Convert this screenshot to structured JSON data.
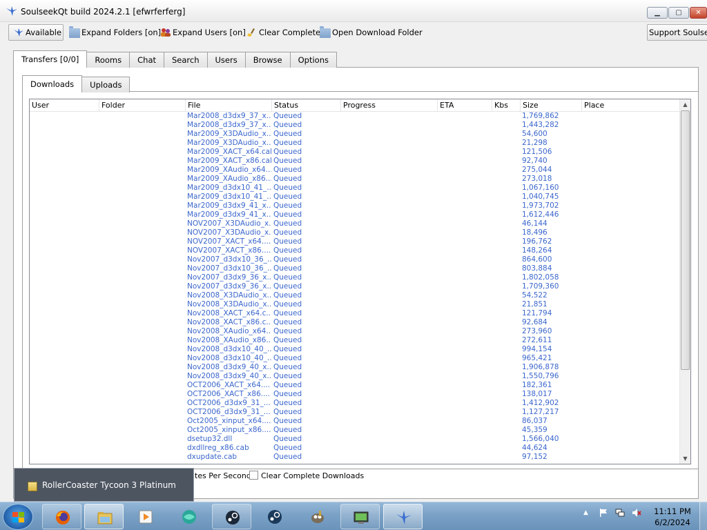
{
  "window": {
    "title": "SoulseekQt build 2024.2.1 [efwrferferg]"
  },
  "toolbar": {
    "available": "Available",
    "expand_folders": "Expand Folders [on]",
    "expand_users": "Expand Users [on]",
    "clear_complete": "Clear Complete",
    "open_download_folder": "Open Download Folder",
    "support": "Support Soulseek"
  },
  "main_tabs": [
    "Transfers [0/0]",
    "Rooms",
    "Chat",
    "Search",
    "Users",
    "Browse",
    "Options"
  ],
  "sub_tabs": [
    "Downloads",
    "Uploads"
  ],
  "columns": [
    "User",
    "Folder",
    "File",
    "Status",
    "Progress",
    "ETA",
    "Kbs",
    "Size",
    "Place"
  ],
  "rows": [
    {
      "file": "Mar2008_d3dx9_37_x...",
      "status": "Queued",
      "size": "1,769,862"
    },
    {
      "file": "Mar2008_d3dx9_37_x...",
      "status": "Queued",
      "size": "1,443,282"
    },
    {
      "file": "Mar2009_X3DAudio_x...",
      "status": "Queued",
      "size": "54,600"
    },
    {
      "file": "Mar2009_X3DAudio_x...",
      "status": "Queued",
      "size": "21,298"
    },
    {
      "file": "Mar2009_XACT_x64.cab",
      "status": "Queued",
      "size": "121,506"
    },
    {
      "file": "Mar2009_XACT_x86.cab",
      "status": "Queued",
      "size": "92,740"
    },
    {
      "file": "Mar2009_XAudio_x64....",
      "status": "Queued",
      "size": "275,044"
    },
    {
      "file": "Mar2009_XAudio_x86....",
      "status": "Queued",
      "size": "273,018"
    },
    {
      "file": "Mar2009_d3dx10_41_...",
      "status": "Queued",
      "size": "1,067,160"
    },
    {
      "file": "Mar2009_d3dx10_41_...",
      "status": "Queued",
      "size": "1,040,745"
    },
    {
      "file": "Mar2009_d3dx9_41_x...",
      "status": "Queued",
      "size": "1,973,702"
    },
    {
      "file": "Mar2009_d3dx9_41_x...",
      "status": "Queued",
      "size": "1,612,446"
    },
    {
      "file": "NOV2007_X3DAudio_x...",
      "status": "Queued",
      "size": "46,144"
    },
    {
      "file": "NOV2007_X3DAudio_x...",
      "status": "Queued",
      "size": "18,496"
    },
    {
      "file": "NOV2007_XACT_x64....",
      "status": "Queued",
      "size": "196,762"
    },
    {
      "file": "NOV2007_XACT_x86....",
      "status": "Queued",
      "size": "148,264"
    },
    {
      "file": "Nov2007_d3dx10_36_...",
      "status": "Queued",
      "size": "864,600"
    },
    {
      "file": "Nov2007_d3dx10_36_...",
      "status": "Queued",
      "size": "803,884"
    },
    {
      "file": "Nov2007_d3dx9_36_x...",
      "status": "Queued",
      "size": "1,802,058"
    },
    {
      "file": "Nov2007_d3dx9_36_x...",
      "status": "Queued",
      "size": "1,709,360"
    },
    {
      "file": "Nov2008_X3DAudio_x...",
      "status": "Queued",
      "size": "54,522"
    },
    {
      "file": "Nov2008_X3DAudio_x...",
      "status": "Queued",
      "size": "21,851"
    },
    {
      "file": "Nov2008_XACT_x64.c...",
      "status": "Queued",
      "size": "121,794"
    },
    {
      "file": "Nov2008_XACT_x86.c...",
      "status": "Queued",
      "size": "92,684"
    },
    {
      "file": "Nov2008_XAudio_x64....",
      "status": "Queued",
      "size": "273,960"
    },
    {
      "file": "Nov2008_XAudio_x86....",
      "status": "Queued",
      "size": "272,611"
    },
    {
      "file": "Nov2008_d3dx10_40_...",
      "status": "Queued",
      "size": "994,154"
    },
    {
      "file": "Nov2008_d3dx10_40_...",
      "status": "Queued",
      "size": "965,421"
    },
    {
      "file": "Nov2008_d3dx9_40_x...",
      "status": "Queued",
      "size": "1,906,878"
    },
    {
      "file": "Nov2008_d3dx9_40_x...",
      "status": "Queued",
      "size": "1,550,796"
    },
    {
      "file": "OCT2006_XACT_x64....",
      "status": "Queued",
      "size": "182,361"
    },
    {
      "file": "OCT2006_XACT_x86....",
      "status": "Queued",
      "size": "138,017"
    },
    {
      "file": "OCT2006_d3dx9_31_...",
      "status": "Queued",
      "size": "1,412,902"
    },
    {
      "file": "OCT2006_d3dx9_31_...",
      "status": "Queued",
      "size": "1,127,217"
    },
    {
      "file": "Oct2005_xinput_x64....",
      "status": "Queued",
      "size": "86,037"
    },
    {
      "file": "Oct2005_xinput_x86....",
      "status": "Queued",
      "size": "45,359"
    },
    {
      "file": "dsetup32.dll",
      "status": "Queued",
      "size": "1,566,040"
    },
    {
      "file": "dxdllreg_x86.cab",
      "status": "Queued",
      "size": "44,624"
    },
    {
      "file": "dxupdate.cab",
      "status": "Queued",
      "size": "97,152"
    }
  ],
  "bottom": {
    "bps_label": "tes Per Second",
    "clear_complete_downloads": "Clear Complete Downloads"
  },
  "popup": {
    "text": "RollerCoaster Tycoon 3 Platinum"
  },
  "taskbar": {
    "items": [
      "firefox-icon",
      "file-explorer-icon",
      "media-player-icon",
      "app-globe-icon",
      "steam-icon",
      "steam-icon-2",
      "gimp-icon",
      "network-monitor-icon",
      "soulseek-icon"
    ],
    "clock_time": "11:11 PM",
    "clock_date": "6/2/2024"
  },
  "colors": {
    "row_text": "#3a66cc",
    "taskbar": "#7aa1c6"
  }
}
